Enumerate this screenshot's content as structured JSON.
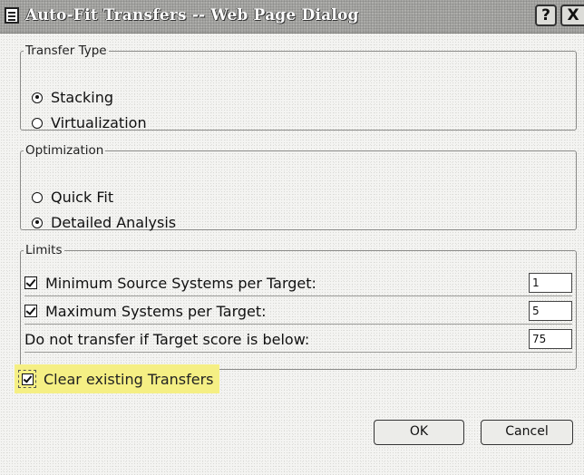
{
  "window": {
    "title": "Auto-Fit Transfers -- Web Page Dialog",
    "help_label": "?",
    "close_label": "X"
  },
  "transfer_type": {
    "legend": "Transfer Type",
    "options": [
      {
        "label": "Stacking",
        "selected": true
      },
      {
        "label": "Virtualization",
        "selected": false
      }
    ]
  },
  "optimization": {
    "legend": "Optimization",
    "options": [
      {
        "label": "Quick Fit",
        "selected": false
      },
      {
        "label": "Detailed Analysis",
        "selected": true
      }
    ]
  },
  "limits": {
    "legend": "Limits",
    "rows": [
      {
        "label": "Minimum Source Systems per Target:",
        "checked": true,
        "value": "1"
      },
      {
        "label": "Maximum Systems per Target:",
        "checked": true,
        "value": "5"
      },
      {
        "label": "Do not transfer if Target score is below:",
        "value": "75"
      }
    ]
  },
  "clear_existing": {
    "label": "Clear existing Transfers",
    "checked": true
  },
  "buttons": {
    "ok": "OK",
    "cancel": "Cancel"
  },
  "colors": {
    "highlight": "#f5ef84",
    "titlebar": "#a9a9a6"
  }
}
